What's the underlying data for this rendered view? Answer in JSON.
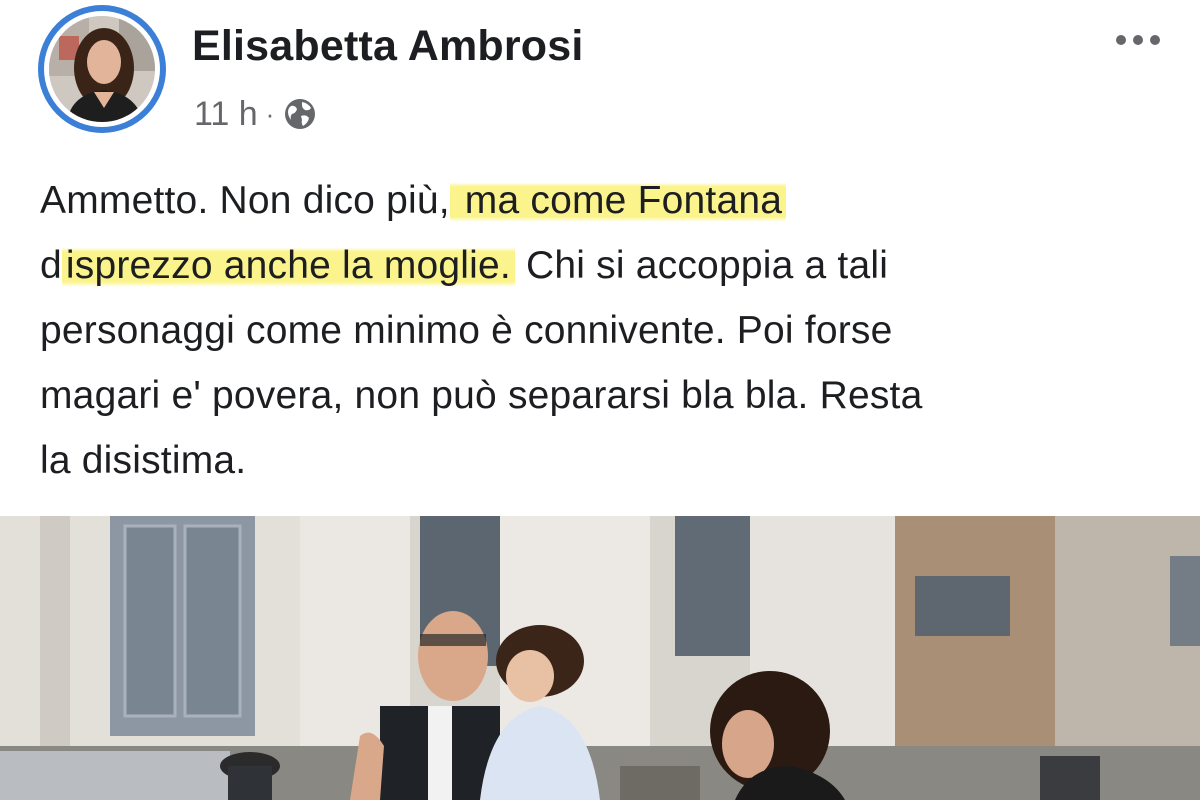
{
  "post": {
    "author": {
      "name": "Elisabetta Ambrosi"
    },
    "timestamp": "11 h",
    "separator": "·",
    "privacy_icon": "globe-icon",
    "more_icon": "more-dots-icon",
    "text_lines": [
      {
        "before": "Ammetto. Non dico più,",
        "highlight": " ma come Fontana",
        "after": ""
      },
      {
        "before": "d",
        "highlight": "isprezzo anche la moglie.",
        "after": " Chi si accoppia a tali"
      },
      {
        "before": "personaggi come minimo è connivente. Poi forse",
        "highlight": "",
        "after": ""
      },
      {
        "before": "magari e' povera, non può separarsi bla bla. Resta",
        "highlight": "",
        "after": ""
      },
      {
        "before": "la disistima.",
        "highlight": "",
        "after": ""
      }
    ],
    "highlight_color": "#faf278",
    "avatar_ring_color": "#3b7fd6",
    "meta_color": "#65676b",
    "photo": {
      "description_icon": "post-photo"
    }
  }
}
